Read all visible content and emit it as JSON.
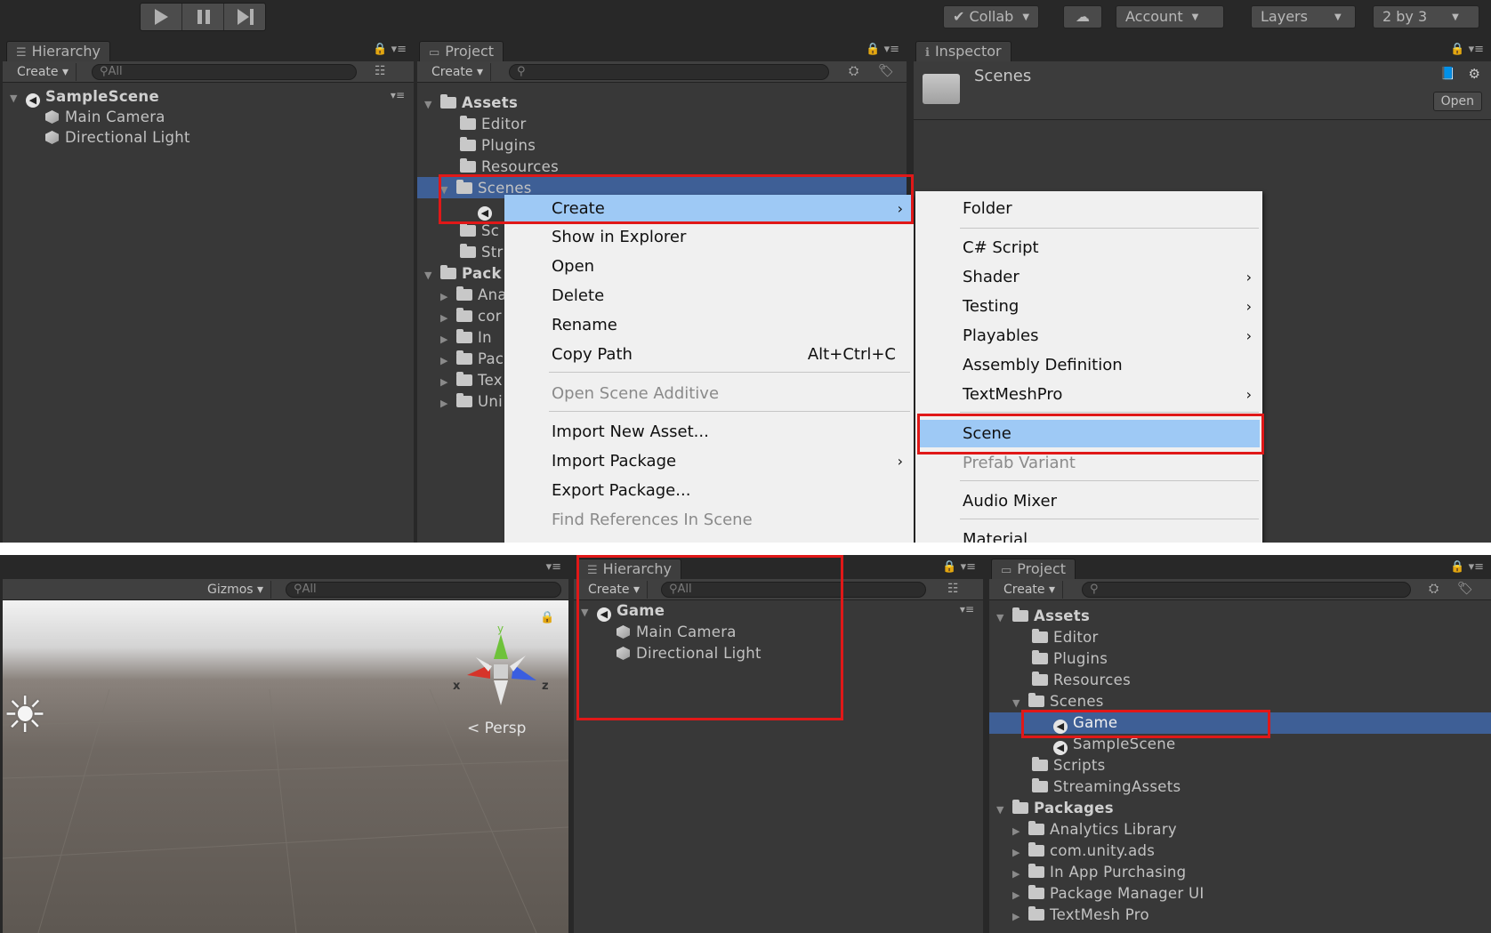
{
  "top_toolbar": {
    "collab": "Collab",
    "account": "Account",
    "layers": "Layers",
    "layout": "2 by 3"
  },
  "hierarchy_top": {
    "tab": "Hierarchy",
    "create": "Create",
    "search_placeholder": "All",
    "scene": "SampleScene",
    "items": [
      "Main Camera",
      "Directional Light"
    ]
  },
  "project_top": {
    "tab": "Project",
    "create": "Create",
    "assets": "Assets",
    "folders": [
      "Editor",
      "Plugins",
      "Resources",
      "Scenes"
    ],
    "partial_rows": [
      "Sc",
      "Str"
    ],
    "packages": "Pack",
    "package_rows": [
      "Ana",
      "cor",
      "In",
      "Pac",
      "Tex",
      "Uni"
    ]
  },
  "inspector": {
    "tab": "Inspector",
    "title": "Scenes",
    "open_button": "Open"
  },
  "context_menu": {
    "items": [
      {
        "label": "Create",
        "arrow": true,
        "highlight": true
      },
      {
        "label": "Show in Explorer"
      },
      {
        "label": "Open"
      },
      {
        "label": "Delete"
      },
      {
        "label": "Rename"
      },
      {
        "label": "Copy Path",
        "shortcut": "Alt+Ctrl+C"
      },
      {
        "label": "Open Scene Additive",
        "disabled": true
      },
      {
        "label": "Import New Asset..."
      },
      {
        "label": "Import Package",
        "arrow": true
      },
      {
        "label": "Export Package..."
      },
      {
        "label": "Find References In Scene",
        "disabled": true
      }
    ]
  },
  "create_submenu": {
    "items": [
      {
        "label": "Folder"
      },
      {
        "label": "C# Script"
      },
      {
        "label": "Shader",
        "arrow": true
      },
      {
        "label": "Testing",
        "arrow": true
      },
      {
        "label": "Playables",
        "arrow": true
      },
      {
        "label": "Assembly Definition"
      },
      {
        "label": "TextMeshPro",
        "arrow": true
      },
      {
        "label": "Scene",
        "highlight": true
      },
      {
        "label": "Prefab Variant",
        "disabled": true
      },
      {
        "label": "Audio Mixer"
      },
      {
        "label": "Material"
      }
    ]
  },
  "scene_view": {
    "gizmos": "Gizmos",
    "search_placeholder": "All",
    "persp": "Persp",
    "axis_x": "x",
    "axis_y": "y",
    "axis_z": "z"
  },
  "hierarchy_bottom": {
    "tab": "Hierarchy",
    "create": "Create",
    "search_placeholder": "All",
    "scene": "Game",
    "items": [
      "Main Camera",
      "Directional Light"
    ]
  },
  "project_bottom": {
    "tab": "Project",
    "create": "Create",
    "assets": "Assets",
    "folders": [
      "Editor",
      "Plugins",
      "Resources",
      "Scenes"
    ],
    "scenes": [
      "Game",
      "SampleScene"
    ],
    "more_folders": [
      "Scripts",
      "StreamingAssets"
    ],
    "packages": "Packages",
    "package_items": [
      "Analytics Library",
      "com.unity.ads",
      "In App Purchasing",
      "Package Manager UI",
      "TextMesh Pro"
    ]
  }
}
